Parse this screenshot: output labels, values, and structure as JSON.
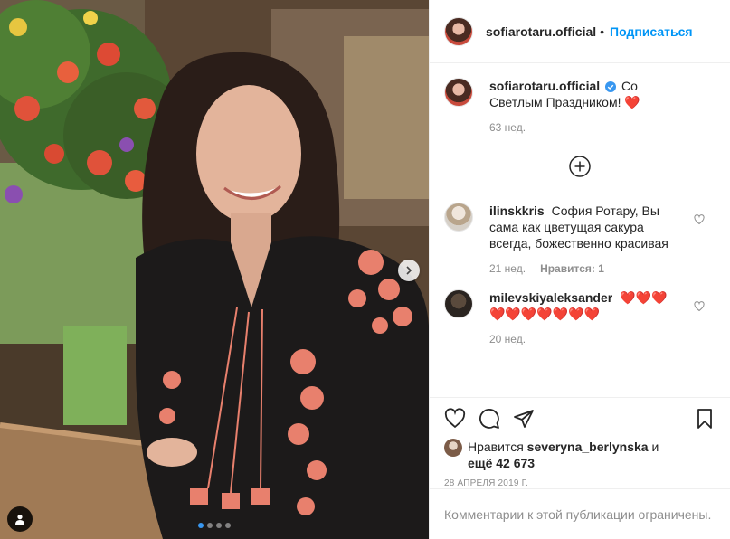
{
  "post": {
    "author": "sofiarotaru.official",
    "separator": "•",
    "follow_label": "Подписаться",
    "caption_text": "Со Светлым Праздником!",
    "caption_emoji": "❤️",
    "caption_time": "63 нед.",
    "load_more_icon": "plus-circle-icon"
  },
  "comments": [
    {
      "user": "ilinskkris",
      "text": "София Ротару, Вы сама как цветущая сакура всегда, божественно красивая",
      "time": "21 нед.",
      "likes": "Нравится: 1"
    },
    {
      "user": "milevskiyaleksander",
      "text": "❤️❤️❤️❤️❤️❤️❤️❤️❤️❤️",
      "time": "20 нед.",
      "likes": ""
    }
  ],
  "likes": {
    "prefix": "Нравится",
    "liker": "severyna_berlynska",
    "and": "и",
    "count": "ещё 42 673"
  },
  "date": "28 АПРЕЛЯ 2019 Г.",
  "restricted_text": "Комментарии к этой публикации ограничены.",
  "carousel": {
    "slides": 4,
    "active": 1
  },
  "colors": {
    "accent": "#0095f6",
    "verified": "#3897f0",
    "heart": "#ed4956",
    "muted": "#8e8e8e"
  }
}
